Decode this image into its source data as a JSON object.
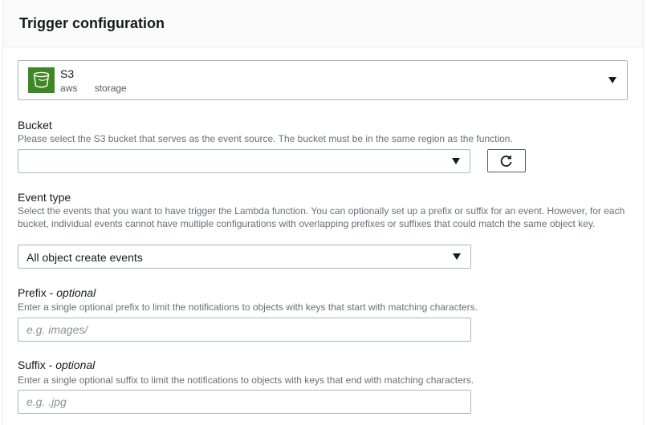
{
  "panel": {
    "title": "Trigger configuration"
  },
  "source": {
    "name": "S3",
    "tags": [
      "aws",
      "storage"
    ],
    "icon": "s3-bucket-icon",
    "tile_color": "#3f8624"
  },
  "bucket": {
    "label": "Bucket",
    "description": "Please select the S3 bucket that serves as the event source. The bucket must be in the same region as the function.",
    "selected": "",
    "refresh_icon": "refresh-icon"
  },
  "event_type": {
    "label": "Event type",
    "description": "Select the events that you want to have trigger the Lambda function. You can optionally set up a prefix or suffix for an event. However, for each bucket, individual events cannot have multiple configurations with overlapping prefixes or suffixes that could match the same object key.",
    "selected": "All object create events"
  },
  "prefix": {
    "label": "Prefix",
    "optional": "optional",
    "description": "Enter a single optional prefix to limit the notifications to objects with keys that start with matching characters.",
    "placeholder": "e.g. images/",
    "value": ""
  },
  "suffix": {
    "label": "Suffix",
    "optional": "optional",
    "description": "Enter a single optional suffix to limit the notifications to objects with keys that end with matching characters.",
    "placeholder": "e.g. .jpg",
    "value": ""
  }
}
